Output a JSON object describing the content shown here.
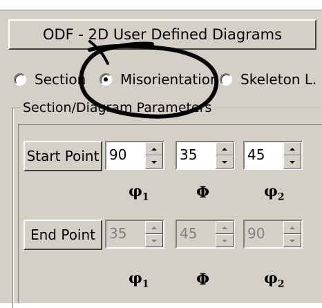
{
  "header": {
    "title": "ODF - 2D User Defined Diagrams"
  },
  "view_modes": {
    "options": [
      {
        "label": "Section",
        "selected": false
      },
      {
        "label": "Misorientation",
        "selected": true
      },
      {
        "label": "Skeleton L.",
        "selected": false
      }
    ]
  },
  "params": {
    "group_label": "Section/Diagram Parameters",
    "start": {
      "button_label": "Start Point",
      "values": [
        "90",
        "35",
        "45"
      ],
      "enabled": true
    },
    "end": {
      "button_label": "End Point",
      "values": [
        "35",
        "45",
        "90"
      ],
      "enabled": false
    },
    "symbols": {
      "phi1_base": "φ",
      "phi1_sub": "1",
      "Phi": "Φ",
      "phi2_base": "φ",
      "phi2_sub": "2"
    }
  },
  "colors": {
    "face": "#d4d0c8",
    "annotation": "#000000"
  },
  "icons": {
    "annotation": "hand-drawn-circle-annotation"
  }
}
